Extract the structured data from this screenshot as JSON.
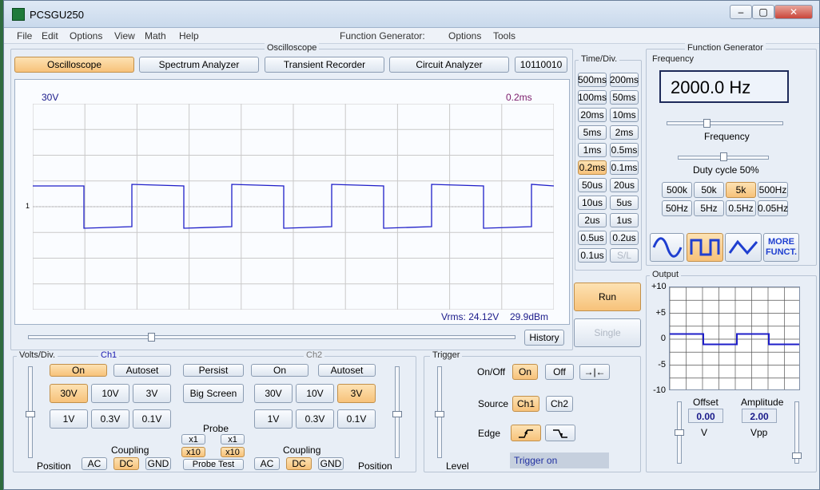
{
  "titlebar": {
    "title": "PCSGU250",
    "minimize": "–",
    "maximize": "▢",
    "close": "✕"
  },
  "menu": {
    "file": "File",
    "edit": "Edit",
    "options": "Options",
    "view": "View",
    "math": "Math",
    "help": "Help",
    "fg": "Function Generator:",
    "fg_options": "Options",
    "tools": "Tools"
  },
  "osc": {
    "group_title": "Oscilloscope",
    "tabs": [
      "Oscilloscope",
      "Spectrum Analyzer",
      "Transient Recorder",
      "Circuit Analyzer",
      "10110010"
    ],
    "volts_label": "30V",
    "time_label": "0.2ms",
    "marker": "1",
    "vrms": "Vrms: 24.12V",
    "dbm": "29.9dBm",
    "history": "History"
  },
  "timediv": {
    "title": "Time/Div.",
    "buttons": [
      [
        "500ms",
        "200ms"
      ],
      [
        "100ms",
        "50ms"
      ],
      [
        "20ms",
        "10ms"
      ],
      [
        "5ms",
        "2ms"
      ],
      [
        "1ms",
        "0.5ms"
      ],
      [
        "0.2ms",
        "0.1ms"
      ],
      [
        "50us",
        "20us"
      ],
      [
        "10us",
        "5us"
      ],
      [
        "2us",
        "1us"
      ],
      [
        "0.5us",
        "0.2us"
      ],
      [
        "0.1us",
        "S/L"
      ]
    ],
    "selected": "0.2ms",
    "disabled": "S/L"
  },
  "run": "Run",
  "single": "Single",
  "volts": {
    "title": "Volts/Div.",
    "ch1": "Ch1",
    "ch2": "Ch2",
    "on": "On",
    "autoset": "Autoset",
    "persist": "Persist",
    "big_screen": "Big Screen",
    "ch1_row1": [
      "30V",
      "10V",
      "3V"
    ],
    "ch1_row2": [
      "1V",
      "0.3V",
      "0.1V"
    ],
    "ch2_row1": [
      "30V",
      "10V",
      "3V"
    ],
    "ch2_row2": [
      "1V",
      "0.3V",
      "0.1V"
    ],
    "probe": "Probe",
    "x1": "x1",
    "x10": "x10",
    "probe_test": "Probe Test",
    "coupling": "Coupling",
    "ac": "AC",
    "dc": "DC",
    "gnd": "GND",
    "position": "Position"
  },
  "trigger": {
    "title": "Trigger",
    "onoff": "On/Off",
    "on": "On",
    "off": "Off",
    "source": "Source",
    "ch1": "Ch1",
    "ch2": "Ch2",
    "edge": "Edge",
    "level": "Level",
    "status": "Trigger on"
  },
  "fg": {
    "title": "Function Generator",
    "freq_label": "Frequency",
    "freq_value": "2000.0 Hz",
    "freq_slider": "Frequency",
    "duty": "Duty cycle 50%",
    "ranges_row1": [
      "500k",
      "50k",
      "5k",
      "500Hz"
    ],
    "ranges_row2": [
      "50Hz",
      "5Hz",
      "0.5Hz",
      "0.05Hz"
    ],
    "more": "MORE\nFUNCT.",
    "output": "Output",
    "yticks": [
      "+10",
      "+5",
      "0",
      "-5",
      "-10"
    ],
    "offset_label": "Offset",
    "offset_value": "0.00",
    "offset_unit": "V",
    "amp_label": "Amplitude",
    "amp_value": "2.00",
    "amp_unit": "Vpp"
  }
}
